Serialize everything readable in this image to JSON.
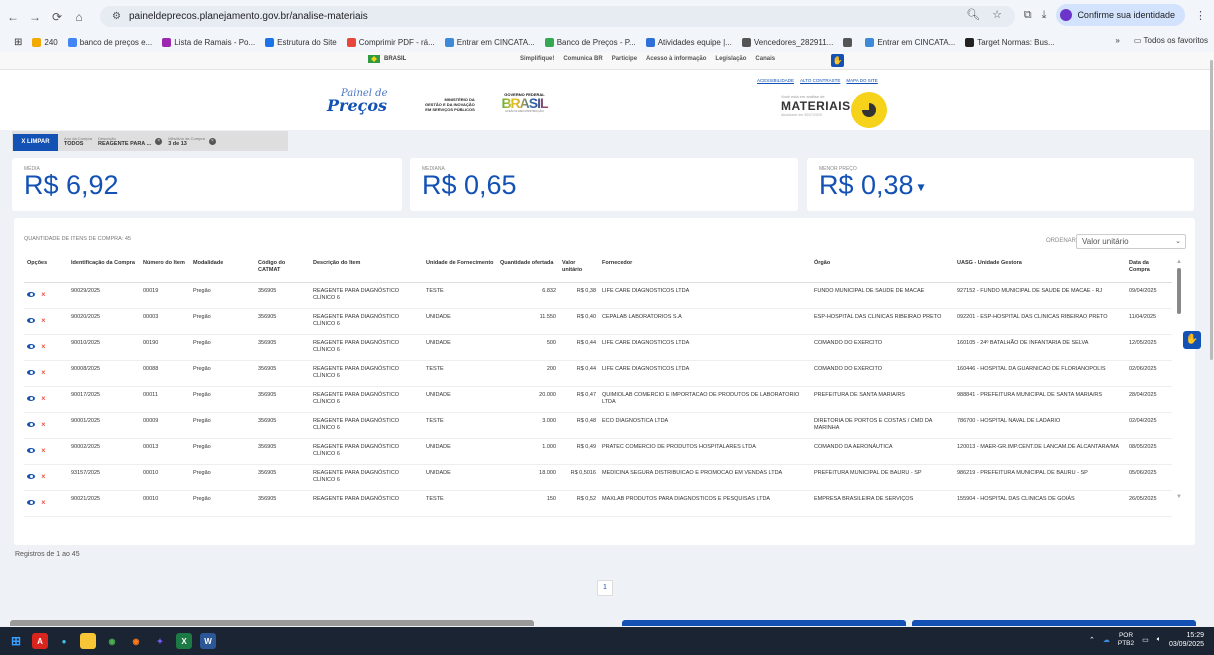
{
  "browser": {
    "url": "paineldeprecos.planejamento.gov.br/analise-materiais",
    "identity_label": "Confirme sua identidade",
    "bookmarks": [
      {
        "label": "240",
        "color": "#f2a900"
      },
      {
        "label": "banco de preços e...",
        "color": "#4285f4"
      },
      {
        "label": "Lista de Ramais - Po...",
        "color": "#9c27b0"
      },
      {
        "label": "Estrutura do Site",
        "color": "#1a73e8"
      },
      {
        "label": "Comprimir PDF - rá...",
        "color": "#e8453c"
      },
      {
        "label": "Entrar em CINCATA...",
        "color": "#3c8ad8"
      },
      {
        "label": "Banco de Preços - P...",
        "color": "#34a853"
      },
      {
        "label": "Atividades equipe |...",
        "color": "#2f6fd8"
      },
      {
        "label": "Vencedores_282911...",
        "color": "#555555"
      },
      {
        "label": "",
        "color": "#555555"
      },
      {
        "label": "Entrar em CINCATA...",
        "color": "#3c8ad8"
      },
      {
        "label": "Target Normas: Bus...",
        "color": "#222222"
      }
    ],
    "all_favorites": "Todos os favoritos"
  },
  "gov_bar": {
    "brasil": "BRASIL",
    "links": [
      "Simplifique!",
      "Comunica BR",
      "Participe",
      "Acesso à informação",
      "Legislação",
      "Canais"
    ]
  },
  "header": {
    "logo_line1": "Painel de",
    "logo_line2": "Preços",
    "ministerio": "MINISTÉRIO DA\nGESTÃO E DA INOVAÇÃO\nEM SERVIÇOS PÚBLICOS",
    "gov_top": "GOVERNO FEDERAL",
    "gov_word": "BRASIL",
    "gov_sub": "UNIÃO E RECONSTRUÇÃO",
    "access_links": [
      "ACESSIBILIDADE",
      "ALTO CONTRASTE",
      "MAPA DO SITE"
    ],
    "mat_small": "Você está em análise de",
    "mat_big": "MATERIAIS",
    "mat_date": "Atualizado em 30/07/2025"
  },
  "filters": {
    "clear_label": "X LIMPAR",
    "chips": [
      {
        "title": "Ano da Compra",
        "value": "TODOS",
        "has_x": false
      },
      {
        "title": "Descrição",
        "value": "REAGENTE PARA ...",
        "has_x": true
      },
      {
        "title": "Mês/Ano da Compra",
        "value": "3 de 13",
        "has_x": true
      }
    ]
  },
  "stats": {
    "media_label": "MÉDIA",
    "media_value": "R$ 6,92",
    "mediana_label": "MEDIANA",
    "mediana_value": "R$ 0,65",
    "menor_label": "MENOR PREÇO",
    "menor_value": "R$ 0,38"
  },
  "table": {
    "quantity_label": "QUANTIDADE DE ITENS DE COMPRA: 45",
    "ordenar_label": "ORDENAR",
    "ordenar_value": "Valor unitário",
    "columns": [
      "Opções",
      "Identificação da Compra",
      "Número do Item",
      "Modalidade",
      "Código do CATMAT",
      "Descrição do Item",
      "Unidade de Fornecimento",
      "Quantidade ofertada",
      "Valor unitário",
      "Fornecedor",
      "Órgão",
      "UASG - Unidade Gestora",
      "Data da Compra"
    ],
    "rows": [
      [
        "90029/2025",
        "00019",
        "Pregão",
        "356905",
        "REAGENTE PARA DIAGNÓSTICO CLÍNICO 6",
        "TESTE",
        "6.832",
        "R$ 0,38",
        "LIFE CARE DIAGNOSTICOS LTDA",
        "FUNDO MUNICIPAL DE SAUDE DE MACAE",
        "927152 - FUNDO MUNICIPAL DE SAUDE DE MACAE - RJ",
        "09/04/2025"
      ],
      [
        "90020/2025",
        "00003",
        "Pregão",
        "356905",
        "REAGENTE PARA DIAGNÓSTICO CLÍNICO 6",
        "UNIDADE",
        "11.550",
        "R$ 0,40",
        "CEPALAB LABORATORIOS S.A",
        "ESP-HOSPITAL DAS CLINICAS RIBEIRAO PRETO",
        "092201 - ESP-HOSPITAL DAS CLINICAS RIBEIRAO PRETO",
        "11/04/2025"
      ],
      [
        "90010/2025",
        "00190",
        "Pregão",
        "356905",
        "REAGENTE PARA DIAGNÓSTICO CLÍNICO 6",
        "UNIDADE",
        "500",
        "R$ 0,44",
        "LIFE CARE DIAGNOSTICOS LTDA",
        "COMANDO DO EXERCITO",
        "160105 - 24º BATALHÃO DE INFANTARIA DE SELVA",
        "12/05/2025"
      ],
      [
        "90008/2025",
        "00088",
        "Pregão",
        "356905",
        "REAGENTE PARA DIAGNÓSTICO CLÍNICO 6",
        "TESTE",
        "200",
        "R$ 0,44",
        "LIFE CARE DIAGNOSTICOS LTDA",
        "COMANDO DO EXERCITO",
        "160446 - HOSPITAL DA GUARNICAO DE FLORIANOPOLIS",
        "02/06/2025"
      ],
      [
        "90017/2025",
        "00011",
        "Pregão",
        "356905",
        "REAGENTE PARA DIAGNÓSTICO CLÍNICO 6",
        "UNIDADE",
        "20.000",
        "R$ 0,47",
        "QUIMIOLAB COMERCIO E IMPORTACAO DE PRODUTOS DE LABORATORIO LTDA",
        "PREFEITURA DE SANTA MARIA/RS",
        "988841 - PREFEITURA MUNICIPAL DE SANTA MARIA/RS",
        "28/04/2025"
      ],
      [
        "90001/2025",
        "00009",
        "Pregão",
        "356905",
        "REAGENTE PARA DIAGNÓSTICO CLÍNICO 6",
        "TESTE",
        "3.000",
        "R$ 0,48",
        "ECO DIAGNOSTICA LTDA",
        "DIRETORIA DE PORTOS E COSTAS / CMD DA MARINHA",
        "786700 - HOSPITAL NAVAL DE LADARIO",
        "02/04/2025"
      ],
      [
        "90002/2025",
        "00013",
        "Pregão",
        "356905",
        "REAGENTE PARA DIAGNÓSTICO CLÍNICO 6",
        "UNIDADE",
        "1.000",
        "R$ 0,49",
        "PRATEC COMERCIO DE PRODUTOS HOSPITALARES LTDA",
        "COMANDO DA AERONÁUTICA",
        "120013 - MAER-GR.IMP.CENT.DE LANCAM.DE ALCANTARA/MA",
        "08/05/2025"
      ],
      [
        "93157/2025",
        "00010",
        "Pregão",
        "356905",
        "REAGENTE PARA DIAGNÓSTICO CLÍNICO 6",
        "UNIDADE",
        "18.000",
        "R$ 0,5016",
        "MEDICINA SEGURA DISTRIBUICAO E PROMOCAO EM VENDAS LTDA",
        "PREFEITURA MUNICIPAL DE BAURU - SP",
        "986219 - PREFEITURA MUNICIPAL DE BAURU - SP",
        "05/06/2025"
      ],
      [
        "90021/2025",
        "00010",
        "Pregão",
        "356905",
        "REAGENTE PARA DIAGNÓSTICO",
        "TESTE",
        "150",
        "R$ 0,52",
        "MAXLAB PRODUTOS PARA DIAGNOSTICOS E PESQUISAS LTDA",
        "EMPRESA BRASILEIRA DE SERVIÇOS",
        "155904 - HOSPITAL DAS CLINICAS DE GOIÁS",
        "26/05/2025"
      ]
    ]
  },
  "footer": {
    "registros": "Registros de 1 ao 45",
    "page": "1"
  },
  "taskbar": {
    "lang1": "POR",
    "lang2": "PTB2",
    "time": "15:29",
    "date": "03/09/2025"
  }
}
